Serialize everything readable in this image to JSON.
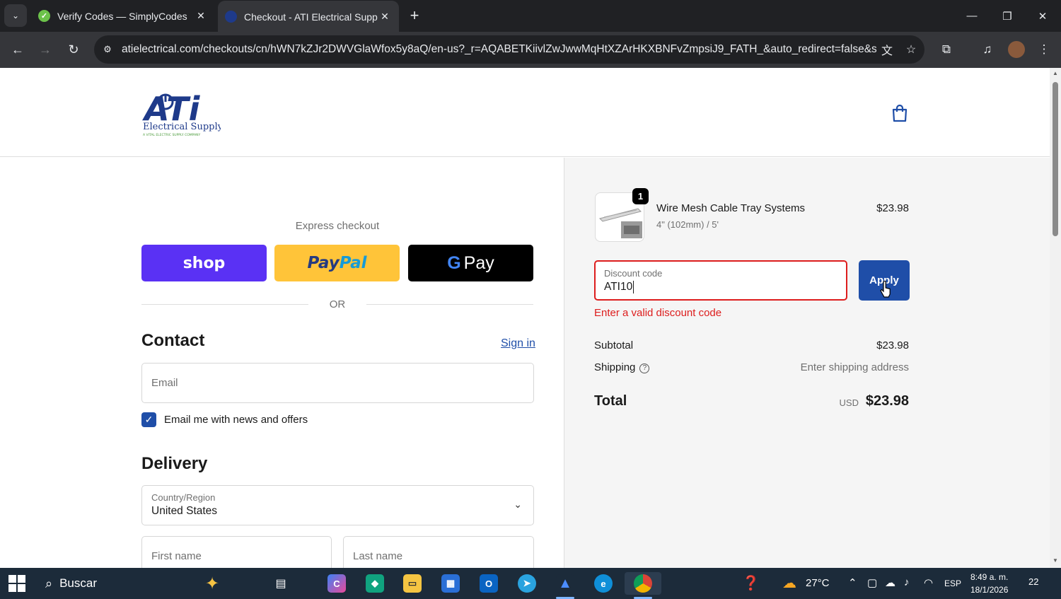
{
  "browser": {
    "tabs": [
      {
        "title": "Verify Codes — SimplyCodes",
        "active": false
      },
      {
        "title": "Checkout - ATI Electrical Supply",
        "active": true
      }
    ],
    "url": "atielectrical.com/checkouts/cn/hWN7kZJr2DWVGlaWfox5y8aQ/en-us?_r=AQABETKiivlZwJwwMqHtXZArHKXBNFvZmpsiJ9_FATH_&auto_redirect=false&s..."
  },
  "store": {
    "logo_text": "ATi",
    "logo_sub": "Electrical Supply",
    "logo_tag": "A VITAL ELECTRIC SUPPLY COMPANY"
  },
  "checkout": {
    "express_label": "Express checkout",
    "shop_label": "shop",
    "paypal_label_1": "Pay",
    "paypal_label_2": "Pal",
    "gpay_label": "Pay",
    "or_label": "OR",
    "contact_heading": "Contact",
    "signin_label": "Sign in",
    "email_placeholder": "Email",
    "newsletter_label": "Email me with news and offers",
    "delivery_heading": "Delivery",
    "country_label": "Country/Region",
    "country_value": "United States",
    "first_name_placeholder": "First name",
    "last_name_placeholder": "Last name"
  },
  "summary": {
    "item": {
      "quantity": "1",
      "name": "Wire Mesh Cable Tray Systems",
      "variant": "4\" (102mm) / 5'",
      "price": "$23.98"
    },
    "discount": {
      "label": "Discount code",
      "value": "ATI10",
      "apply_label": "Apply",
      "error": "Enter a valid discount code"
    },
    "subtotal_label": "Subtotal",
    "subtotal_value": "$23.98",
    "shipping_label": "Shipping",
    "shipping_value": "Enter shipping address",
    "total_label": "Total",
    "total_currency": "USD",
    "total_value": "$23.98"
  },
  "taskbar": {
    "search_label": "Buscar",
    "temperature": "27°C",
    "language": "ESP",
    "time": "8:49 a. m.",
    "date": "18/1/2026",
    "notifications": "22"
  },
  "colors": {
    "brand_blue": "#1f4ea8",
    "error_red": "#dd1d1d",
    "shop_purple": "#5a31f4",
    "paypal_yellow": "#ffc439"
  }
}
